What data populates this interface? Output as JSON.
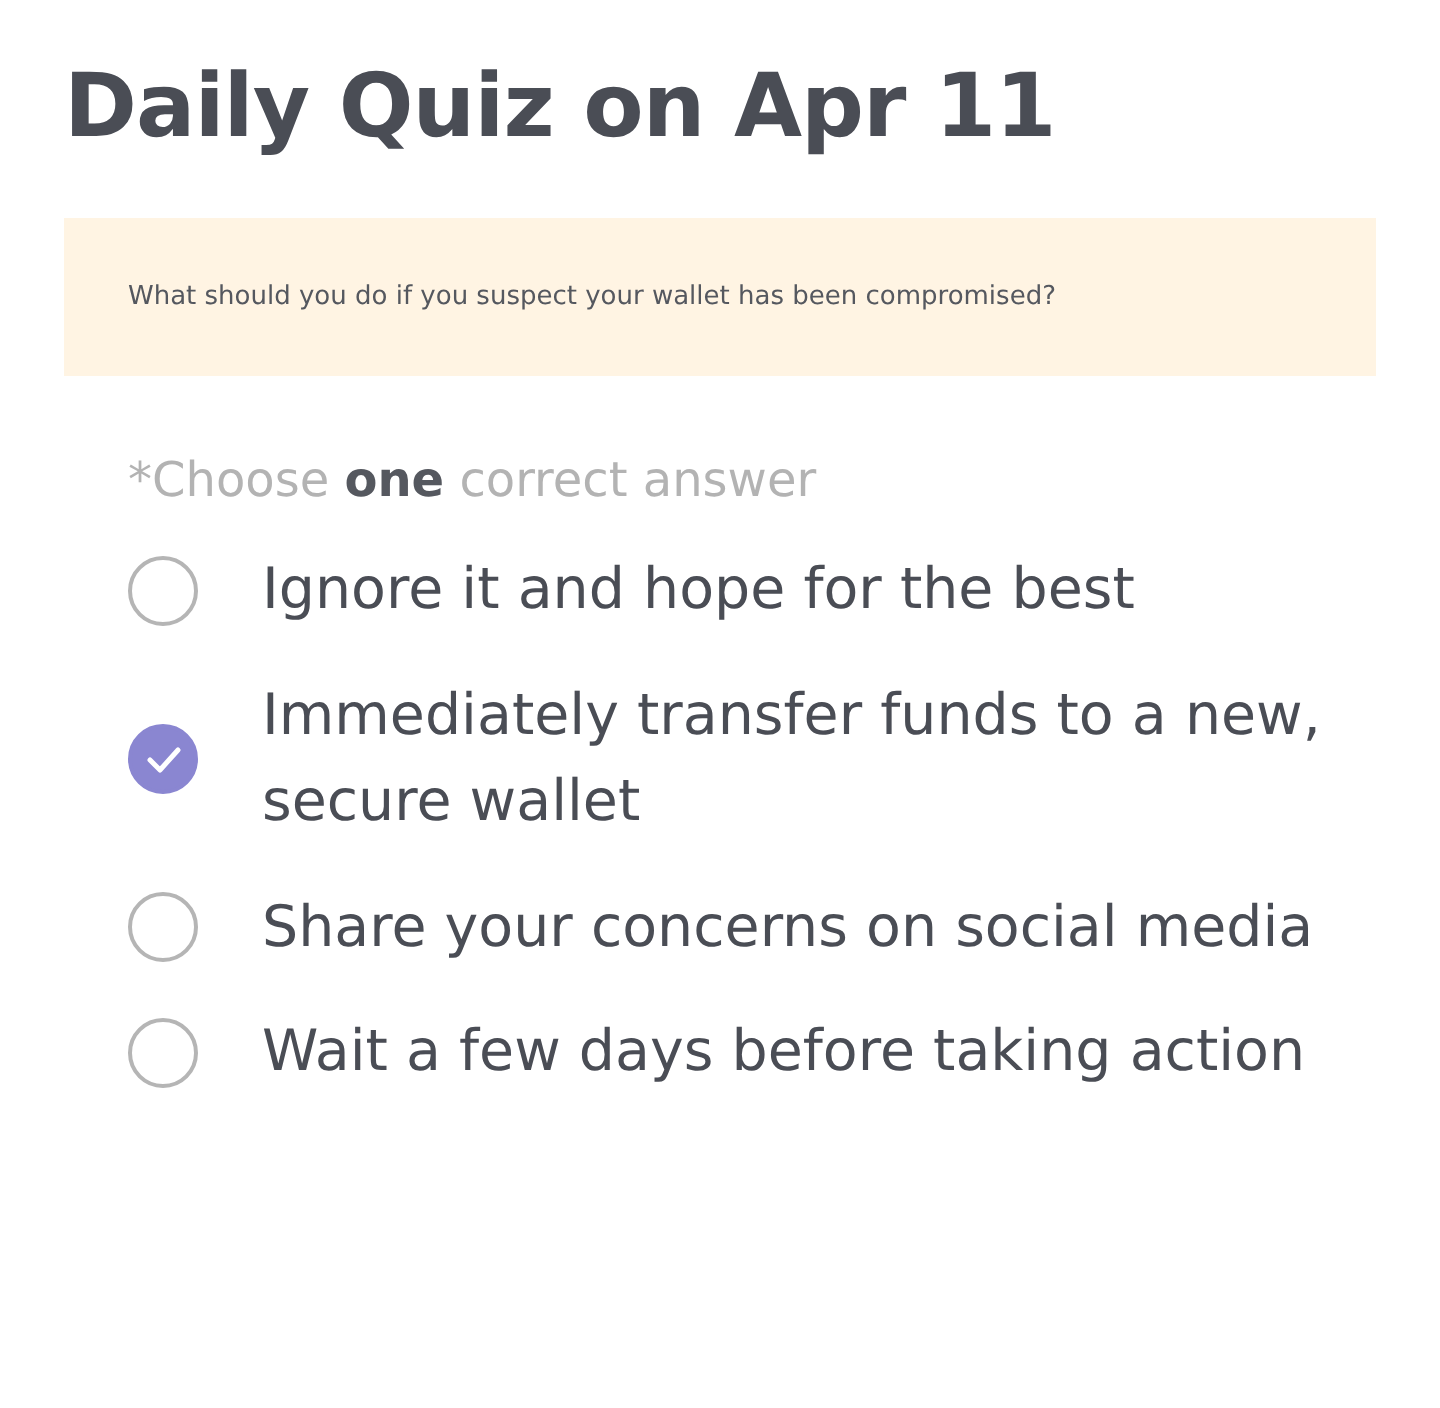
{
  "title": "Daily Quiz on Apr 11",
  "question": "What should you do if you suspect your wallet has been compromised?",
  "instruction": "*Choose **one** correct answer",
  "options": [
    {
      "label": "Ignore it and hope for the best",
      "selected": false
    },
    {
      "label": "Immediately transfer funds to a new, secure wallet",
      "selected": true
    },
    {
      "label": "Share your concerns on social media",
      "selected": false
    },
    {
      "label": "Wait a few days before taking action",
      "selected": false
    }
  ]
}
